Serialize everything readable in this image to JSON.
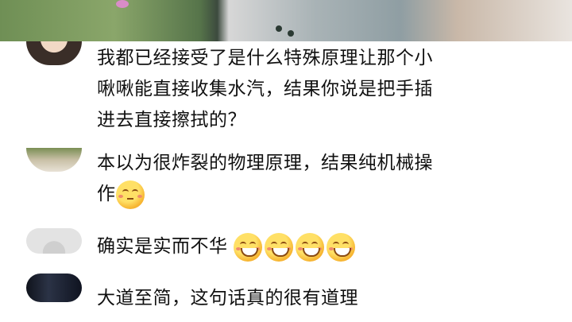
{
  "comments": [
    {
      "lines": [
        "我都已经接受了是什么特殊原理让那个小",
        "啾啾能直接收集水汽，结果你说是把手插",
        "进去直接擦拭的？"
      ]
    },
    {
      "lines": [
        "本以为很炸裂的物理原理，结果纯机械操",
        "作"
      ],
      "emojis": [
        "speechless-face-emoji"
      ]
    },
    {
      "lines": [
        "确实是实而不华"
      ],
      "emojis": [
        "grinning-face-emoji",
        "grinning-face-emoji",
        "grinning-face-emoji",
        "grinning-face-emoji"
      ]
    },
    {
      "lines": [
        "大道至简，这句话真的很有道理"
      ]
    }
  ]
}
